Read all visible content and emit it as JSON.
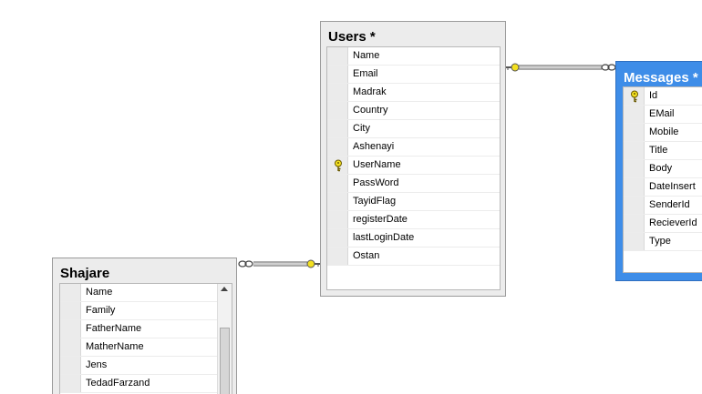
{
  "tables": {
    "users": {
      "title": "Users *",
      "columns": [
        {
          "name": "Name",
          "key": false
        },
        {
          "name": "Email",
          "key": false
        },
        {
          "name": "Madrak",
          "key": false
        },
        {
          "name": "Country",
          "key": false
        },
        {
          "name": "City",
          "key": false
        },
        {
          "name": "Ashenayi",
          "key": false
        },
        {
          "name": "UserName",
          "key": true
        },
        {
          "name": "PassWord",
          "key": false
        },
        {
          "name": "TayidFlag",
          "key": false
        },
        {
          "name": "registerDate",
          "key": false
        },
        {
          "name": "lastLoginDate",
          "key": false
        },
        {
          "name": "Ostan",
          "key": false
        }
      ]
    },
    "messages": {
      "title": "Messages *",
      "selected": true,
      "columns": [
        {
          "name": "Id",
          "key": true
        },
        {
          "name": "EMail",
          "key": false
        },
        {
          "name": "Mobile",
          "key": false
        },
        {
          "name": "Title",
          "key": false
        },
        {
          "name": "Body",
          "key": false
        },
        {
          "name": "DateInsert",
          "key": false
        },
        {
          "name": "SenderId",
          "key": false
        },
        {
          "name": "RecieverId",
          "key": false
        },
        {
          "name": "Type",
          "key": false
        }
      ]
    },
    "shajare": {
      "title": "Shajare",
      "columns": [
        {
          "name": "Name",
          "key": false
        },
        {
          "name": "Family",
          "key": false
        },
        {
          "name": "FatherName",
          "key": false
        },
        {
          "name": "MatherName",
          "key": false
        },
        {
          "name": "Jens",
          "key": false
        },
        {
          "name": "TedadFarzand",
          "key": false
        }
      ]
    }
  },
  "icons": {
    "primary_key": "key-icon",
    "relationship_one": "key-icon",
    "relationship_many": "infinity-icon",
    "scroll_up": "arrow-up-icon"
  },
  "colors": {
    "selected_header": "#3e8de8",
    "key_yellow": "#f3e020",
    "relationship_line": "#444444"
  }
}
